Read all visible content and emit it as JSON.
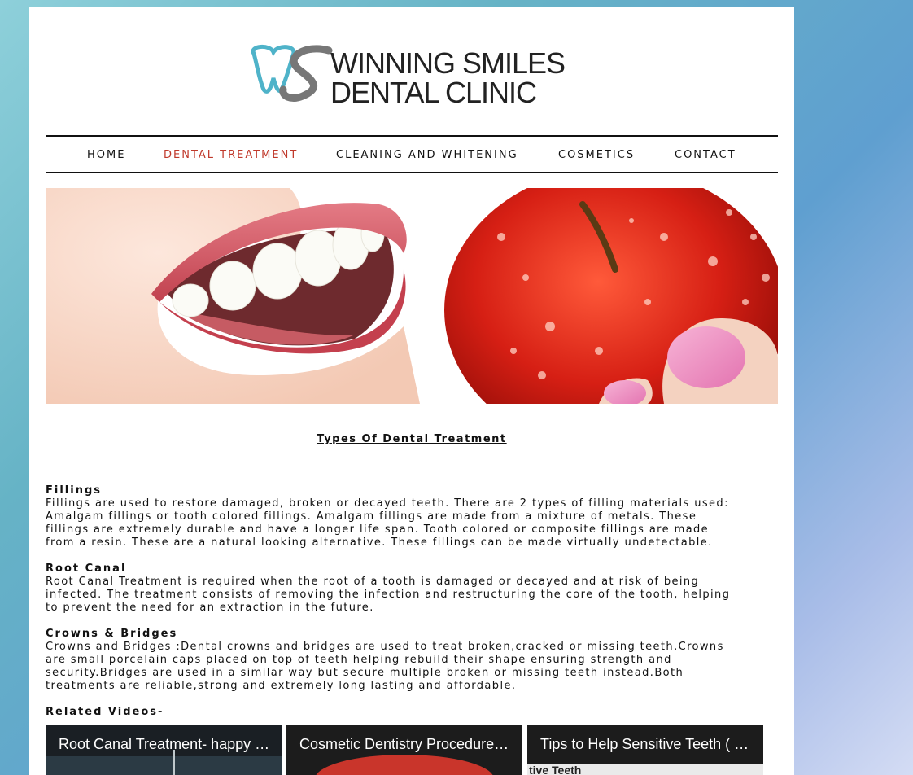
{
  "logo": {
    "line1": "WINNING SMILES",
    "line2": "DENTAL CLINIC",
    "brand_color": "#4fb3c9"
  },
  "nav": {
    "items": [
      {
        "label": "HOME"
      },
      {
        "label": "DENTAL TREATMENT",
        "active": true
      },
      {
        "label": "CLEANING AND WHITENING"
      },
      {
        "label": "COSMETICS"
      },
      {
        "label": "CONTACT"
      }
    ],
    "active_color": "#c0392b"
  },
  "hero": {
    "description": "smile-and-apple-banner"
  },
  "main": {
    "heading": "Types Of Dental Treatment",
    "sections": [
      {
        "title": "Fillings",
        "lines": [
          "Fillings are used to restore damaged, broken or decayed teeth. There are 2 types of filling materials used:",
          "Amalgam fillings or tooth colored fillings. Amalgam fillings are made from a mixture of metals. These",
          "fillings are extremely durable and have a longer life span. Tooth colored or composite fillings are made",
          "from a resin. These are a natural looking alternative. These fillings can be made virtually undetectable."
        ]
      },
      {
        "title": "Root Canal",
        "lines": [
          "Root Canal Treatment is required when the root of a tooth is damaged or decayed and at risk of being",
          "infected. The treatment consists of removing the infection and restructuring the core of the tooth, helping",
          "to prevent the need for an extraction in the future."
        ]
      },
      {
        "title": "Crowns & Bridges",
        "lines": [
          "Crowns and Bridges :Dental crowns and bridges are used to treat broken,cracked or missing teeth.Crowns",
          "are small porcelain caps placed on top of teeth helping rebuild their shape ensuring strength and",
          "security.Bridges are used in a similar way but secure multiple broken or missing teeth instead.Both",
          "treatments are reliable,strong and extremely long lasting and affordable."
        ]
      }
    ],
    "related_label": "Related Videos-"
  },
  "videos": [
    {
      "title": "Root Canal Treatment- happy d...",
      "thumb_caption": ""
    },
    {
      "title": "Cosmetic Dentistry Procedures...",
      "thumb_caption": ""
    },
    {
      "title": "Tips to Help Sensitive Teeth ( D...",
      "thumb_caption": "tive Teeth"
    }
  ]
}
